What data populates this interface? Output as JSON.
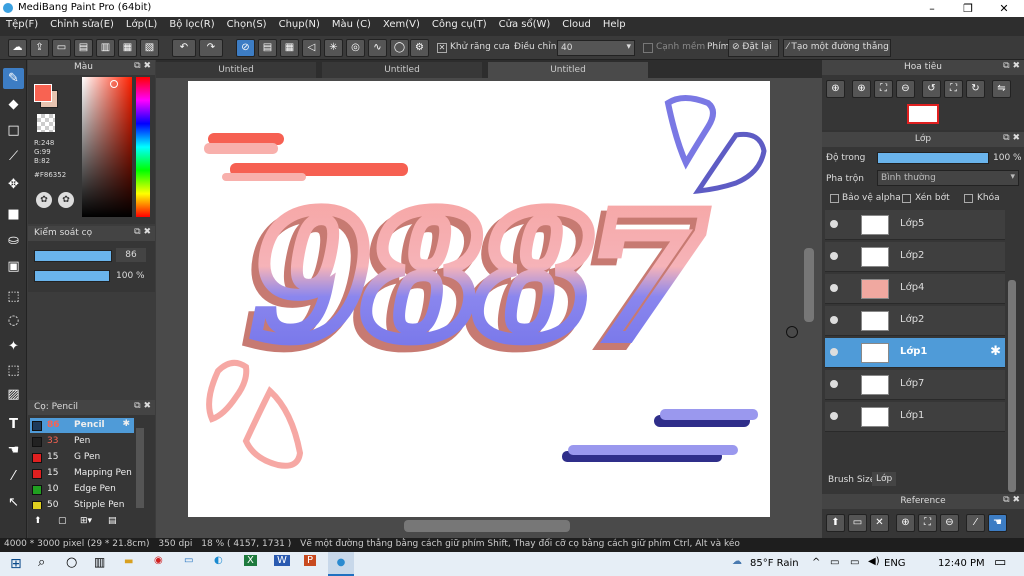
{
  "window": {
    "title": "MediBang Paint Pro (64bit)",
    "controls": [
      "–",
      "❐",
      "✕"
    ]
  },
  "menu": [
    "Tệp(F)",
    "Chỉnh sửa(E)",
    "Lớp(L)",
    "Bộ lọc(R)",
    "Chọn(S)",
    "Chụp(N)",
    "Màu (C)",
    "Xem(V)",
    "Công cụ(T)",
    "Cửa sổ(W)",
    "Cloud",
    "Help"
  ],
  "toolbar": {
    "antialias_label": "Khử răng cưa",
    "adjust_label": "Điều chỉnh",
    "adjust_value": "40",
    "smooth_label": "Cạnh mềm",
    "key_label": "Phím",
    "reset_label": "Đặt lại",
    "straight_label": "Tạo một đường thẳng"
  },
  "color_panel": {
    "title": "Màu",
    "r": "R:248",
    "g": "G:99",
    "b": "B:82",
    "hex": "#F86352",
    "primary": "#F86352"
  },
  "brush_control": {
    "title": "Kiểm soát cọ",
    "size": "86",
    "opacity": "100 %"
  },
  "brush_panel": {
    "title": "Cọ: Pencil",
    "items": [
      {
        "size": "86",
        "name": "Pencil",
        "color": "#1e3a5a"
      },
      {
        "size": "33",
        "name": "Pen",
        "color": "#222222"
      },
      {
        "size": "15",
        "name": "G Pen",
        "color": "#e02020"
      },
      {
        "size": "15",
        "name": "Mapping Pen",
        "color": "#e02020"
      },
      {
        "size": "10",
        "name": "Edge Pen",
        "color": "#20a020"
      },
      {
        "size": "50",
        "name": "Stipple Pen",
        "color": "#e0d020"
      }
    ]
  },
  "tabs": [
    "Untitled",
    "Untitled",
    "Untitled"
  ],
  "navigator": {
    "title": "Hoa tiêu"
  },
  "layer_panel": {
    "title": "Lớp",
    "opacity_label": "Độ trong",
    "opacity_value": "100 %",
    "blend_label": "Pha trộn",
    "blend_value": "Bình thường",
    "protect_alpha": "Bảo vệ alpha",
    "clipping": "Xén bớt",
    "lock": "Khóa",
    "layers": [
      "Lớp5",
      "Lớp2",
      "Lớp4",
      "Lớp2",
      "Lớp1",
      "Lớp7",
      "Lớp1"
    ],
    "selected_index": 4
  },
  "bottom_tabs": [
    "Brush Size",
    "Lớp"
  ],
  "reference": {
    "title": "Reference"
  },
  "status": {
    "size": "4000 * 3000 pixel",
    "cm": "(29 * 21.8cm)",
    "dpi": "350 dpi",
    "zoom": "18 %",
    "coords": "( 4157, 1731 )",
    "hint": "Vẽ một đường thẳng bằng cách giữ phím Shift, Thay đổi cỡ cọ bằng cách giữ phím Ctrl, Alt và kéo"
  },
  "taskbar": {
    "weather": "85°F  Rain",
    "lang": "ENG",
    "time": "12:40 PM"
  },
  "artwork": {
    "text": "9887"
  }
}
